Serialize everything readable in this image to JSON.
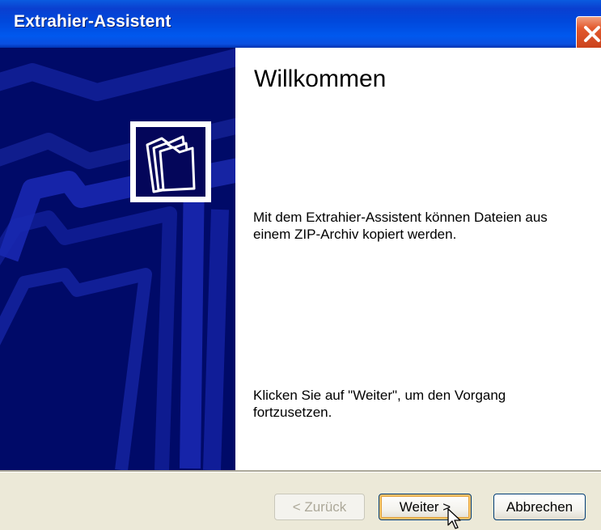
{
  "window": {
    "title": "Extrahier-Assistent"
  },
  "page": {
    "heading": "Willkommen",
    "description": "Mit dem Extrahier-Assistent können Dateien aus einem ZIP-Archiv kopiert werden.",
    "hint": "Klicken Sie auf \"Weiter\", um den Vorgang fortzusetzen."
  },
  "buttons": {
    "back_label": "< Zurück",
    "next_label": "Weiter >",
    "cancel_label": "Abbrechen"
  },
  "icons": {
    "close": "close-icon",
    "wizard": "folders-icon",
    "cursor": "mouse-pointer-icon"
  },
  "colors": {
    "titlebar": "#0054e3",
    "side_panel": "#000a68",
    "close_button": "#e35a2e",
    "dialog_background": "#ece9d8"
  }
}
